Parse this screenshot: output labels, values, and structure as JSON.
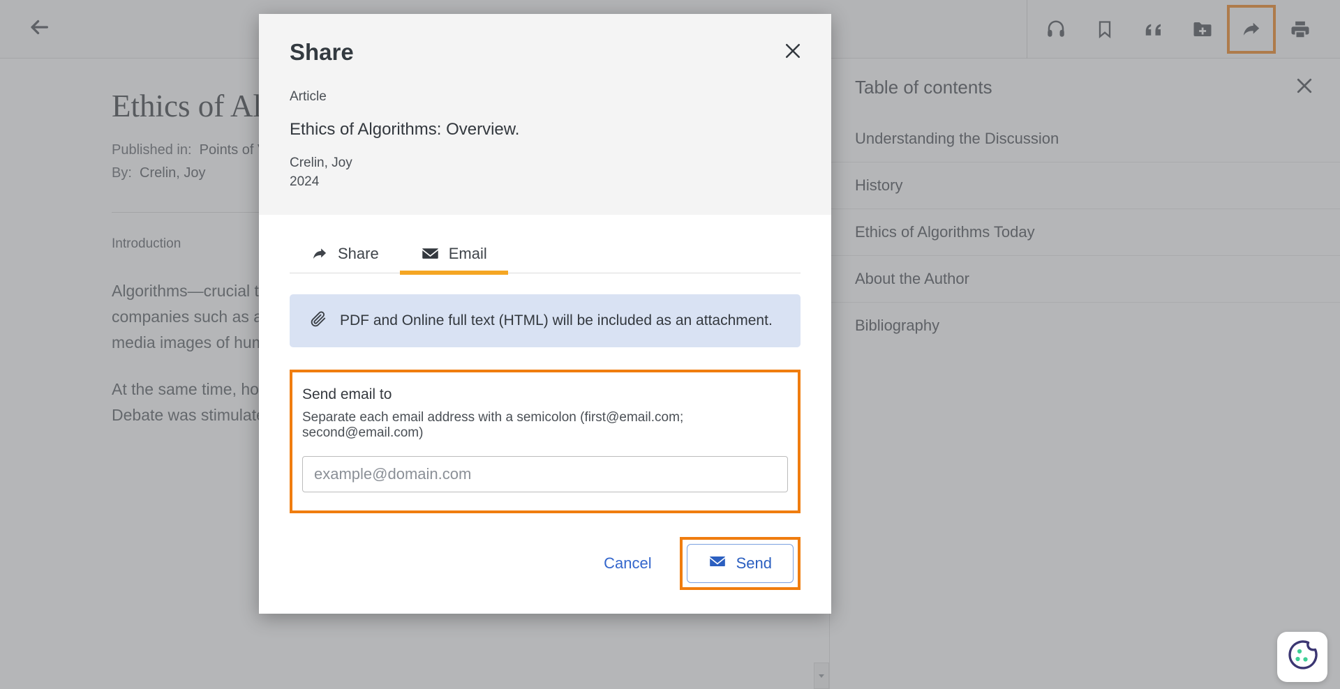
{
  "topbar": {
    "back_icon": "back-arrow-icon",
    "tools": [
      {
        "name": "listen-icon",
        "label": "Listen"
      },
      {
        "name": "bookmark-icon",
        "label": "Save"
      },
      {
        "name": "cite-icon",
        "label": "Cite"
      },
      {
        "name": "add-to-folder-icon",
        "label": "Add to folder"
      },
      {
        "name": "share-icon",
        "label": "Share",
        "highlighted": true
      },
      {
        "name": "print-icon",
        "label": "Print"
      }
    ]
  },
  "article": {
    "title": "Ethics of Algorithms: Overview.",
    "published_label": "Published in:",
    "published_value": "Points of View Reference Center",
    "by_label": "By:",
    "by_value": "Crelin, Joy",
    "section_heading": "Introduction",
    "paragraphs": [
      "Algorithms—crucial to modern computing—took on even greater importance as technology companies such as artificial intelligence became increasingly common, including serving social media images of human faces.",
      "At the same time, however, the ethical implications of algorithms made questionable decisions. Debate was stimulated by 2023 with the release and relatively widespread adoption of the artificial-"
    ]
  },
  "toc": {
    "title": "Table of contents",
    "close_icon": "close-icon",
    "items": [
      {
        "label": "Understanding the Discussion"
      },
      {
        "label": "History"
      },
      {
        "label": "Ethics of Algorithms Today"
      },
      {
        "label": "About the Author"
      },
      {
        "label": "Bibliography"
      }
    ]
  },
  "modal": {
    "title": "Share",
    "close_icon": "close-icon",
    "doc_type": "Article",
    "doc_title": "Ethics of Algorithms: Overview.",
    "doc_author": "Crelin, Joy",
    "doc_year": "2024",
    "tabs": [
      {
        "label": "Share",
        "icon": "share-icon",
        "active": false
      },
      {
        "label": "Email",
        "icon": "envelope-icon",
        "active": true
      }
    ],
    "attachment_note": "PDF and Online full text (HTML) will be included as an attachment.",
    "attachment_icon": "paperclip-icon",
    "email": {
      "label": "Send email to",
      "hint": "Separate each email address with a semicolon (first@email.com; second@email.com)",
      "placeholder": "example@domain.com",
      "value": ""
    },
    "cancel_label": "Cancel",
    "send_label": "Send",
    "send_icon": "envelope-icon"
  },
  "cookie_widget": {
    "icon": "cookie-icon",
    "label": "Cookie preferences"
  },
  "colors": {
    "accent_orange": "#f5a623",
    "highlight_orange": "#f07d0f",
    "link_blue": "#3366cc",
    "button_blue": "#2b5fc0",
    "note_blue_bg": "#d9e2f3"
  }
}
